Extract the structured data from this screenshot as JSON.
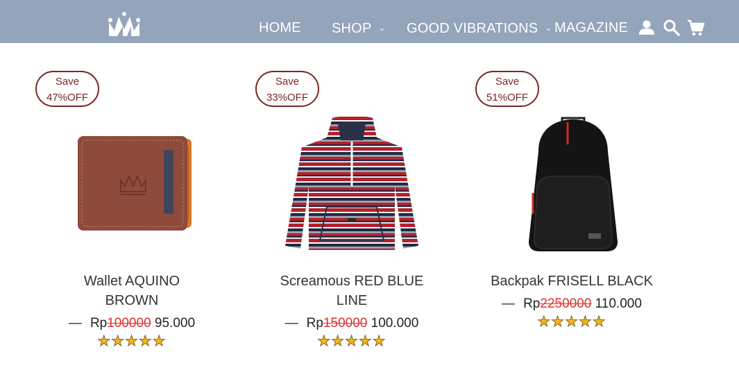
{
  "nav": {
    "items": [
      {
        "label": "HOME"
      },
      {
        "label": "SHOP"
      },
      {
        "label": "GOOD VIBRATIONS"
      },
      {
        "label": "MAGAZINE"
      }
    ],
    "icons": [
      "crown-logo",
      "user-icon",
      "search-icon",
      "cart-icon"
    ]
  },
  "products": [
    {
      "badge_line1": "Save",
      "badge_line2": "47%OFF",
      "name_line1": "Wallet AQUINO",
      "name_line2": "BROWN",
      "dash": "—",
      "currency": "Rp",
      "old_price": "100000",
      "new_price": "95.000",
      "stars": "★★★★★",
      "image": "wallet"
    },
    {
      "badge_line1": "Save",
      "badge_line2": "33%OFF",
      "name_line1": "Screamous RED BLUE",
      "name_line2": "LINE",
      "dash": "—",
      "currency": "Rp",
      "old_price": "150000",
      "new_price": "100.000",
      "stars": "★★★★★",
      "image": "hoodie"
    },
    {
      "badge_line1": "Save",
      "badge_line2": "51%OFF",
      "name_line1": "Backpak FRISELL BLACK",
      "name_line2": "",
      "dash": "—",
      "currency": "Rp",
      "old_price": "2250000",
      "new_price": "110.000",
      "stars": "★★★★★",
      "image": "backpack"
    }
  ],
  "colors": {
    "header": "#93a4bb",
    "badge": "#7a2424",
    "old_price": "#e22d2d",
    "star": "#f4b521"
  }
}
